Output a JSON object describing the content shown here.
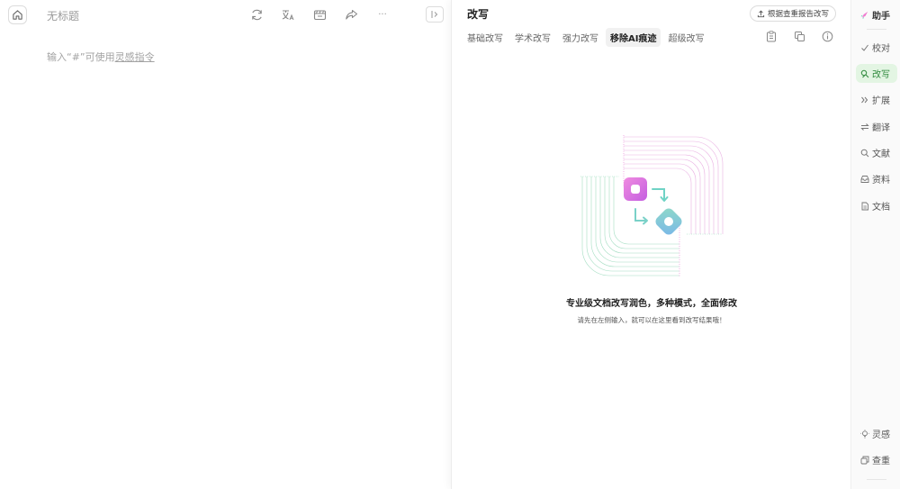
{
  "editor": {
    "title": "无标题",
    "hint_prefix": "输入“#”可使用",
    "hint_link": "灵感指令",
    "toolbar_icons": [
      "refresh-icon",
      "translate-icon",
      "clapper-icon",
      "share-icon",
      "more-icon"
    ],
    "more_label": "···"
  },
  "panel": {
    "title": "改写",
    "report_button": "根据查重报告改写",
    "tabs": [
      {
        "label": "基础改写",
        "active": false
      },
      {
        "label": "学术改写",
        "active": false
      },
      {
        "label": "强力改写",
        "active": false
      },
      {
        "label": "移除AI痕迹",
        "active": true
      },
      {
        "label": "超级改写",
        "active": false
      }
    ],
    "empty_title": "专业级文档改写润色，多种模式，全面修改",
    "empty_subtitle": "请先在左侧输入，就可以在这里看到改写结果哦！"
  },
  "sidebar": {
    "items": [
      {
        "label": "助手",
        "icon": "rocket-icon"
      },
      {
        "label": "校对",
        "icon": "check-icon"
      },
      {
        "label": "改写",
        "icon": "rewrite-icon",
        "active": true
      },
      {
        "label": "扩展",
        "icon": "expand-icon"
      },
      {
        "label": "翻译",
        "icon": "swap-icon"
      },
      {
        "label": "文献",
        "icon": "search-icon"
      },
      {
        "label": "资料",
        "icon": "inbox-icon"
      },
      {
        "label": "文档",
        "icon": "document-icon"
      },
      {
        "label": "灵感",
        "icon": "bulb-icon"
      },
      {
        "label": "查重",
        "icon": "duplicate-icon"
      }
    ]
  },
  "colors": {
    "active_green_bg": "#e3f5e3",
    "active_green_text": "#2f8a3d",
    "accent_pink": "#e46bd3",
    "accent_teal": "#6fd9b9"
  }
}
